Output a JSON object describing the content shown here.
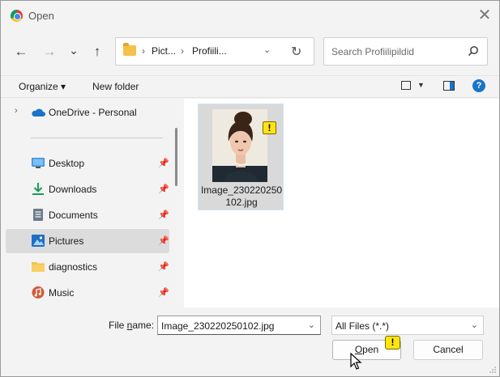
{
  "window": {
    "title": "Open",
    "close_glyph": "✕"
  },
  "nav": {
    "back_glyph": "←",
    "forward_glyph": "→",
    "recent_glyph": "⌄",
    "up_glyph": "↑",
    "breadcrumbs": [
      "Pict...",
      "Profiili..."
    ],
    "separator": "›",
    "dropdown_glyph": "⌄",
    "refresh_glyph": "↻",
    "search_placeholder": "Search Profiilipildid"
  },
  "toolbar": {
    "organize_label": "Organize ▾",
    "new_folder_label": "New folder",
    "view_caret": "▼",
    "help_glyph": "?"
  },
  "sidebar": {
    "onedrive": {
      "label": "OneDrive - Personal",
      "icon": "cloud-icon",
      "expander": "›"
    },
    "pin_glyph": "📌",
    "items": [
      {
        "label": "Desktop",
        "icon": "desktop-icon",
        "selected": false
      },
      {
        "label": "Downloads",
        "icon": "download-icon",
        "selected": false
      },
      {
        "label": "Documents",
        "icon": "documents-icon",
        "selected": false
      },
      {
        "label": "Pictures",
        "icon": "pictures-icon",
        "selected": true
      },
      {
        "label": "diagnostics",
        "icon": "folder-icon",
        "selected": false
      },
      {
        "label": "Music",
        "icon": "music-icon",
        "selected": false
      }
    ]
  },
  "files": [
    {
      "name": "Image_230220250102.jpg",
      "badge": "!",
      "selected": true
    }
  ],
  "bottom": {
    "file_name_label_pre": "File ",
    "file_name_label_accel": "n",
    "file_name_label_post": "ame:",
    "file_name_value": "Image_230220250102.jpg",
    "file_type_value": "All Files (*.*)",
    "open_label_accel": "O",
    "open_label_rest": "pen",
    "open_badge": "!",
    "cancel_label": "Cancel"
  },
  "colors": {
    "accent": "#1a73c9",
    "warning": "#ffe414",
    "selection": "#dcdcdc",
    "folder": "#f5c14b"
  }
}
